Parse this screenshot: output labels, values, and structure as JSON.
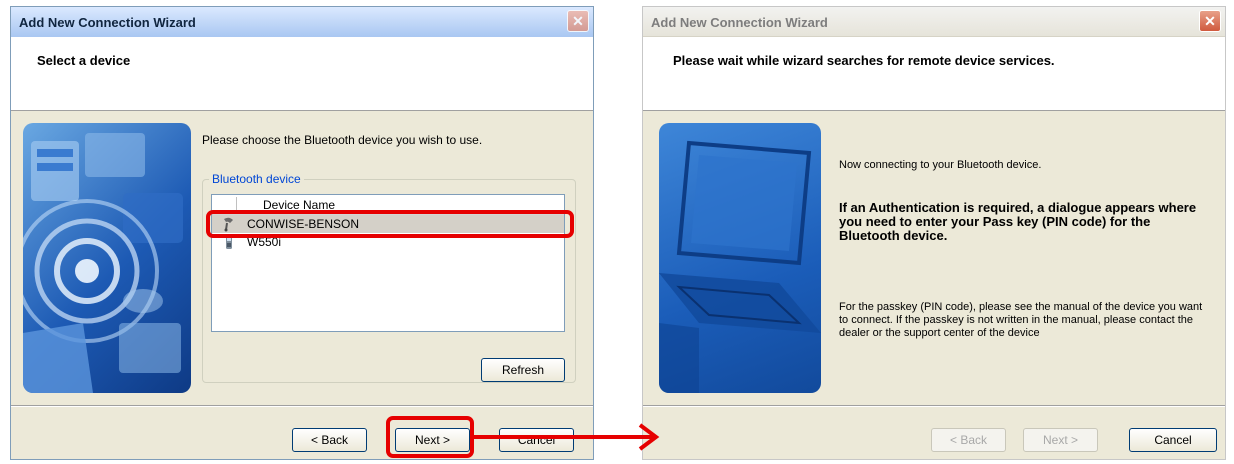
{
  "left_window": {
    "title": "Add New Connection Wizard",
    "close_glyph": "✕",
    "header": "Select a device",
    "prompt": "Please choose the Bluetooth device you wish to use.",
    "group_label": "Bluetooth device",
    "column_header": "Device Name",
    "devices": [
      {
        "name": "CONWISE-BENSON",
        "icon": "bluetooth-headset-icon",
        "selected": true
      },
      {
        "name": "W550i",
        "icon": "mobile-phone-icon",
        "selected": false
      }
    ],
    "buttons": {
      "refresh": "Refresh",
      "back": "< Back",
      "next": "Next >",
      "cancel": "Cancel"
    }
  },
  "right_window": {
    "title": "Add New Connection Wizard",
    "close_glyph": "✕",
    "header": "Please wait while wizard searches for remote device services.",
    "connecting_text": "Now connecting to your Bluetooth device.",
    "auth_text": "If an Authentication is required, a dialogue appears where you need to enter your Pass key (PIN code) for the Bluetooth device.",
    "passkey_text": "For the passkey (PIN code), please see the manual of the device you want to connect. If the passkey is not written in the manual, please contact the dealer or the support center of the device",
    "buttons": {
      "back": "< Back",
      "next": "Next >",
      "cancel": "Cancel"
    }
  },
  "colors": {
    "highlight": "#e60000",
    "wizard_bg": "#ece9d8",
    "accent_blue": "#1d5ab4"
  }
}
